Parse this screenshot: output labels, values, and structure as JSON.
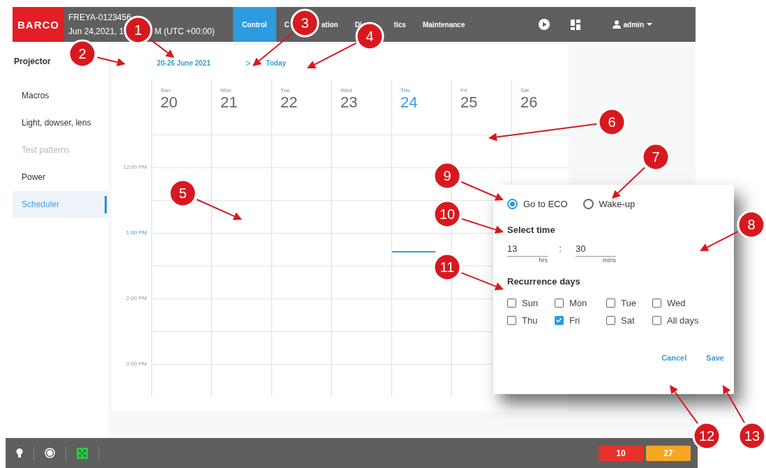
{
  "header": {
    "logo": "BARCO",
    "device_name": "FREYA-0123456",
    "datetime_parts": [
      "Jun 24,2021, 1",
      "M (UTC +00:00)"
    ],
    "tabs": [
      {
        "parts": [
          "Control"
        ],
        "selected": true
      },
      {
        "parts": [
          "C",
          "ation"
        ],
        "selected": false
      },
      {
        "parts": [
          "Di",
          "tics"
        ],
        "selected": false
      },
      {
        "parts": [
          "Maintenance"
        ],
        "selected": false
      }
    ],
    "user": "admin"
  },
  "sidebar": {
    "title": "Projector",
    "items": [
      {
        "label": "Macros",
        "selected": false,
        "disabled": false
      },
      {
        "label": "Light, dowser, lens",
        "selected": false,
        "disabled": false
      },
      {
        "label": "Test patterns",
        "selected": false,
        "disabled": true
      },
      {
        "label": "Power",
        "selected": false,
        "disabled": false
      },
      {
        "label": "Scheduler",
        "selected": true,
        "disabled": false
      }
    ]
  },
  "calendar": {
    "range": "20-26 June 2021",
    "next": ">",
    "today": "Today",
    "days": [
      {
        "weekday": "Sun",
        "date": "20",
        "selected": false
      },
      {
        "weekday": "Mon",
        "date": "21",
        "selected": false
      },
      {
        "weekday": "Tue",
        "date": "22",
        "selected": false
      },
      {
        "weekday": "Wed",
        "date": "23",
        "selected": false
      },
      {
        "weekday": "Thu",
        "date": "24",
        "selected": true
      },
      {
        "weekday": "Fri",
        "date": "25",
        "selected": false
      },
      {
        "weekday": "Sat",
        "date": "26",
        "selected": false
      }
    ],
    "times": [
      {
        "label": "12:00 PM",
        "current": false
      },
      {
        "label": "1:00 PM",
        "current": true
      },
      {
        "label": "2:00 PM",
        "current": false
      },
      {
        "label": "3:00 PM",
        "current": false
      }
    ]
  },
  "dialog": {
    "modes": [
      {
        "label": "Go to ECO",
        "selected": true
      },
      {
        "label": "Wake-up",
        "selected": false
      }
    ],
    "select_time": "Select time",
    "hours": "13",
    "hours_unit": "hrs",
    "separator": ":",
    "minutes": "30",
    "minutes_unit": "mins",
    "recurrence_title": "Recurrence days",
    "days": [
      {
        "label": "Sun",
        "checked": false
      },
      {
        "label": "Mon",
        "checked": false
      },
      {
        "label": "Tue",
        "checked": false
      },
      {
        "label": "Wed",
        "checked": false
      },
      {
        "label": "Thu",
        "checked": false
      },
      {
        "label": "Fri",
        "checked": true
      },
      {
        "label": "Sat",
        "checked": false
      },
      {
        "label": "All days",
        "checked": false
      }
    ],
    "buttons": [
      "Cancel",
      "Save"
    ]
  },
  "footer": {
    "badges": [
      {
        "text": "10",
        "color": "#e8312a"
      },
      {
        "text": "27",
        "color": "#f5a623"
      }
    ]
  },
  "callouts": [
    "1",
    "2",
    "3",
    "4",
    "5",
    "6",
    "7",
    "8",
    "9",
    "10",
    "11",
    "12",
    "13"
  ]
}
